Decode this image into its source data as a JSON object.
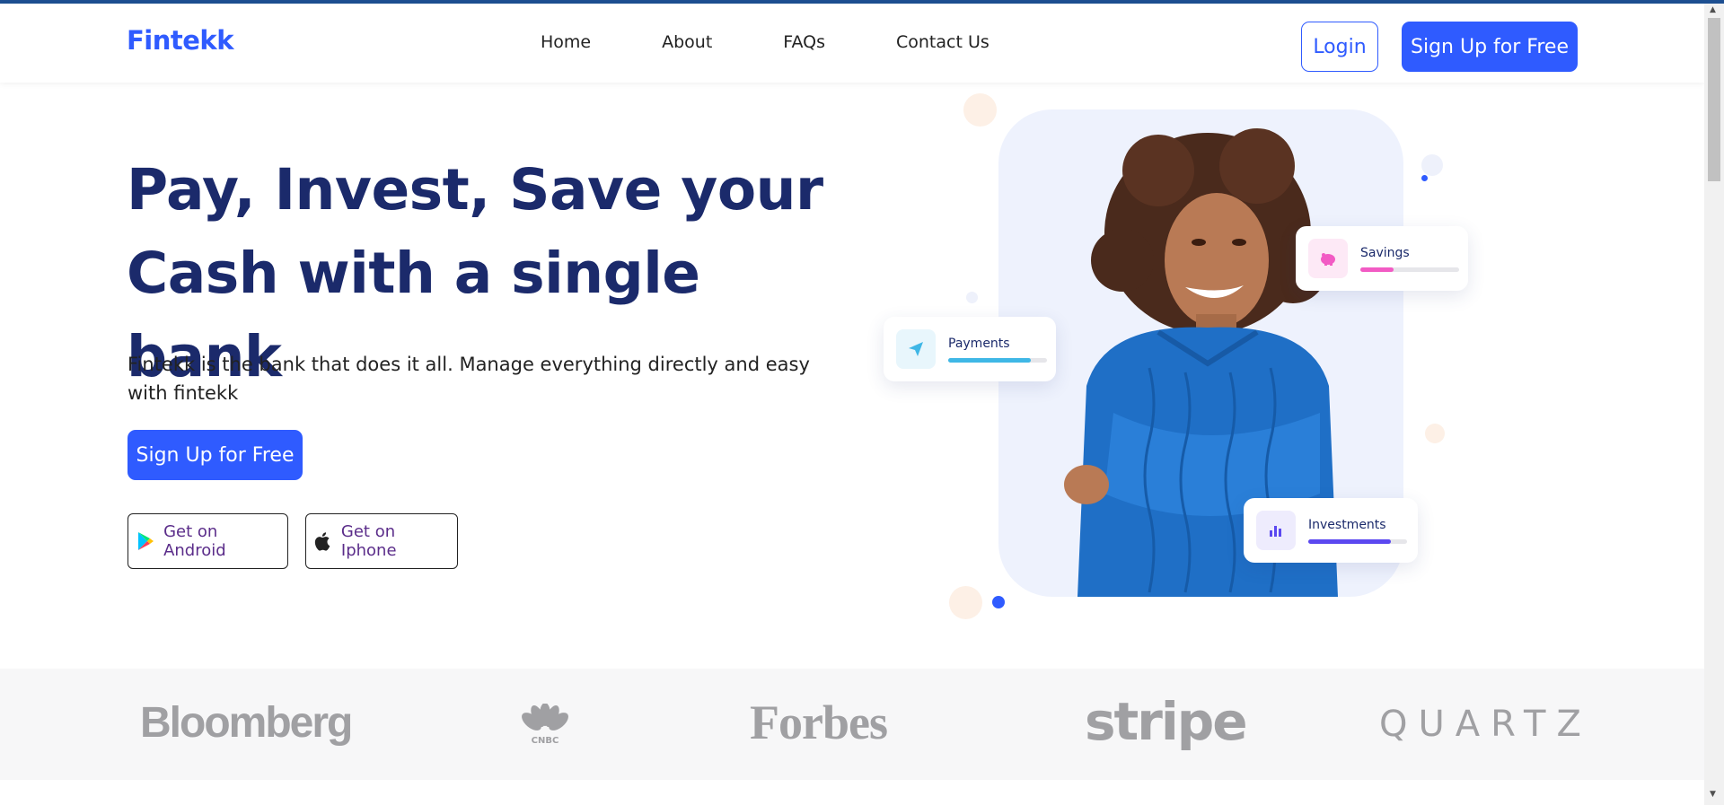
{
  "header": {
    "logo": "Fintekk",
    "nav": [
      "Home",
      "About",
      "FAQs",
      "Contact Us"
    ],
    "login_label": "Login",
    "signup_label": "Sign Up for Free"
  },
  "hero": {
    "title_line1": "Pay, Invest, Save your",
    "title_line2": "Cash with a single bank",
    "subtitle": "Fintekk is the bank that does it all. Manage everything directly and easy with fintekk",
    "signup_label": "Sign Up for Free",
    "android_label": "Get on Android",
    "iphone_label": "Get on Iphone"
  },
  "cards": {
    "savings": {
      "label": "Savings",
      "progress": 0.34,
      "color": "#f25bc4"
    },
    "payments": {
      "label": "Payments",
      "progress": 0.84,
      "color": "#3fb7e6"
    },
    "investments": {
      "label": "Investments",
      "progress": 0.84,
      "color": "#5b48f0"
    }
  },
  "press_logos": [
    "Bloomberg",
    "CNBC",
    "Forbes",
    "stripe",
    "QUARTZ"
  ],
  "colors": {
    "brand": "#2f5bff",
    "heading": "#1b2a6b"
  }
}
